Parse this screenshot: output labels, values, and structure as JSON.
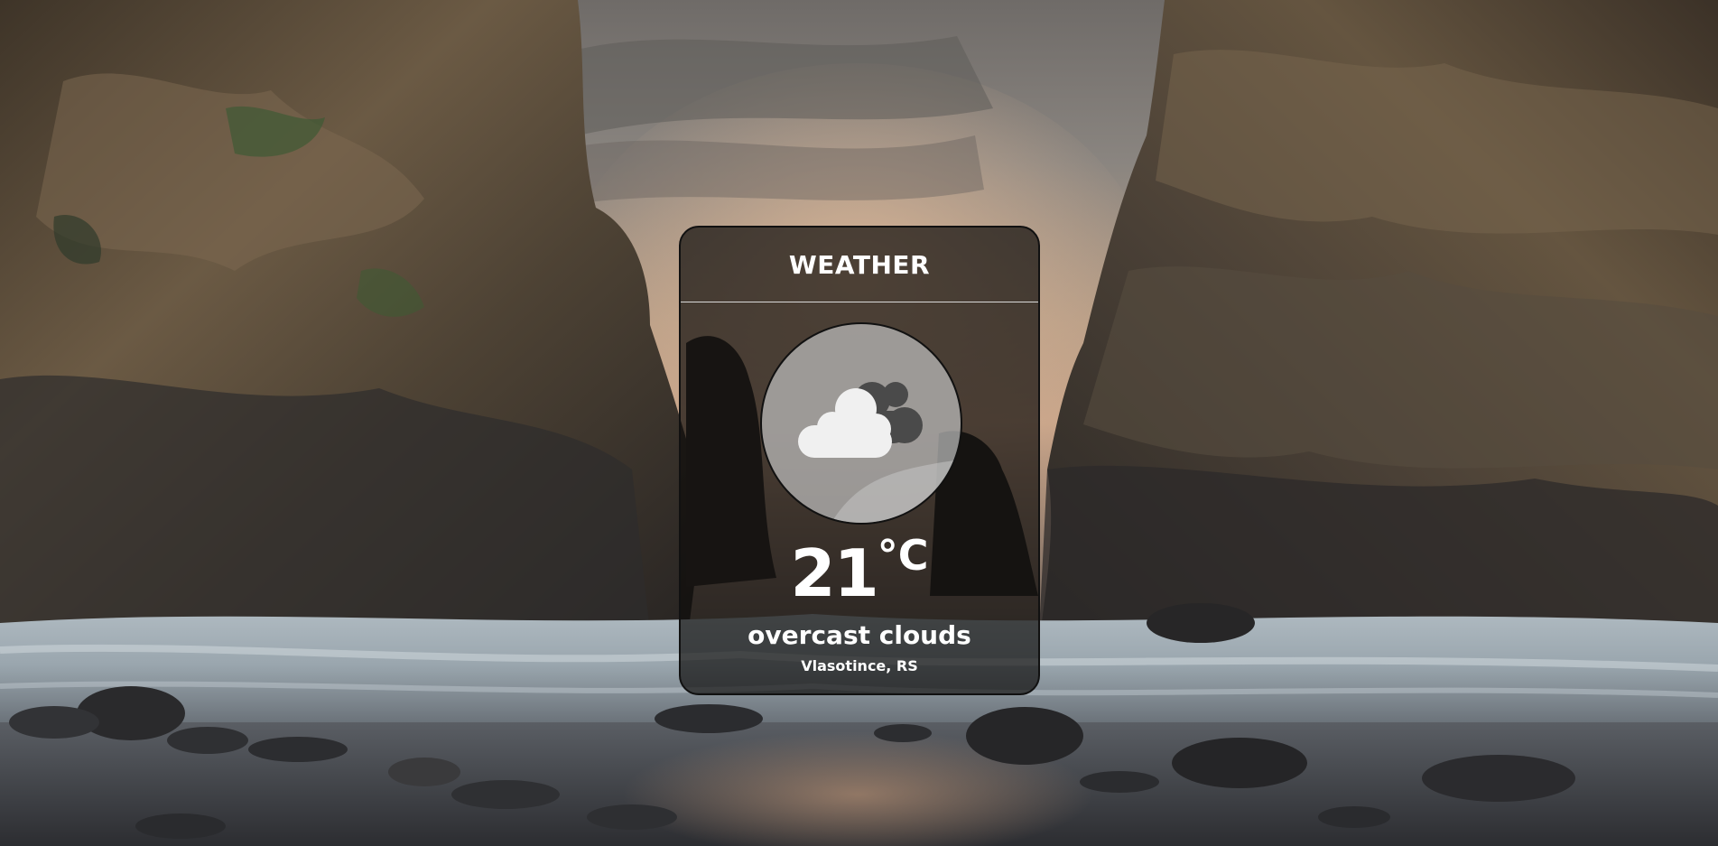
{
  "widget": {
    "title": "WEATHER",
    "icon": "overcast-clouds-icon",
    "temperature": "21",
    "unit": "°C",
    "description": "overcast clouds",
    "location": "Vlasotince, RS"
  },
  "background": {
    "subject": "beach-rocks-photo",
    "colors": {
      "sky_top": "#7d7872",
      "sky_glow": "#c9a58a",
      "rock": "#5a4a38",
      "rock_dark": "#2a2622",
      "water": "#b8c2c8",
      "sand": "#3a3a3c"
    }
  },
  "card": {
    "background": "#0c0a09",
    "border": "#111111",
    "icon_circle": "#bebebe"
  }
}
